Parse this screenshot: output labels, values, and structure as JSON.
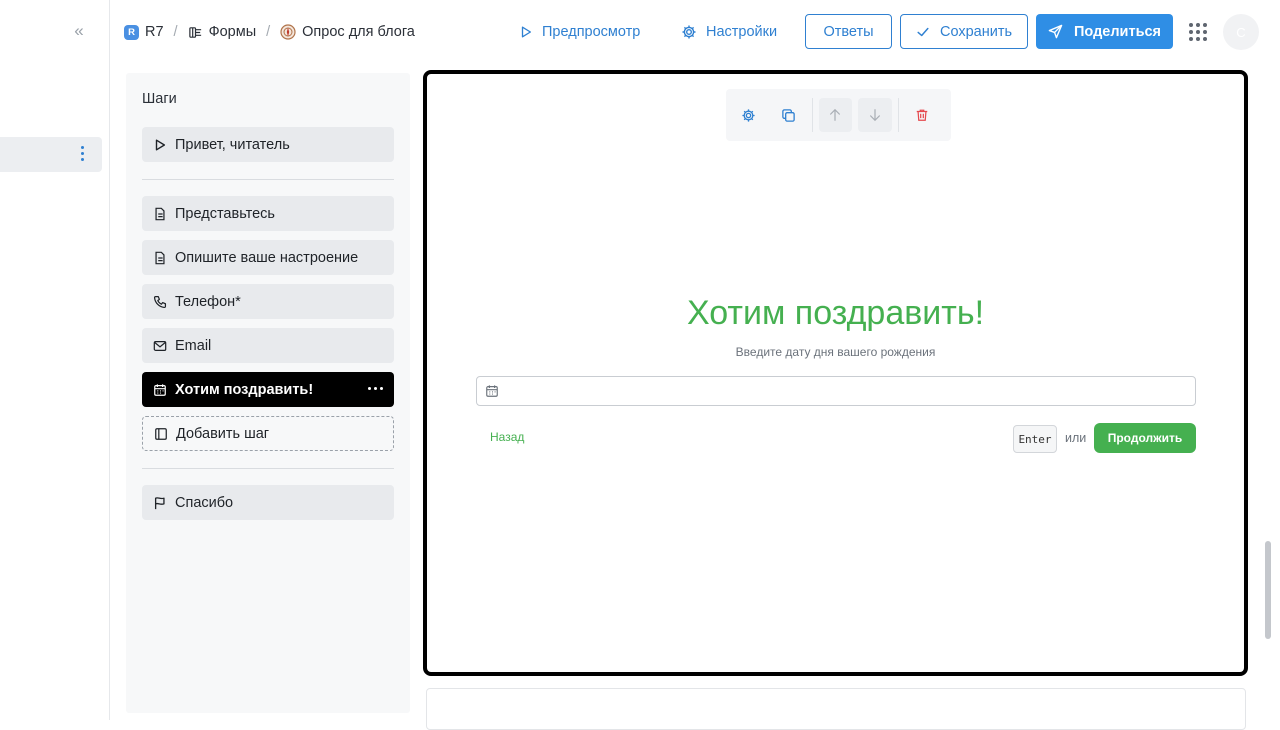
{
  "breadcrumbs": {
    "workspace_badge": "R",
    "workspace": "R7",
    "section": "Формы",
    "form": "Опрос для блога"
  },
  "header": {
    "preview_label": "Предпросмотр",
    "settings_label": "Настройки",
    "responses_label": "Ответы",
    "save_label": "Сохранить",
    "share_label": "Поделиться",
    "avatar_initial": "C"
  },
  "steps": {
    "title": "Шаги",
    "welcome": {
      "label": "Привет, читатель",
      "icon": "play-icon"
    },
    "items": [
      {
        "label": "Представьтесь",
        "icon": "document-icon"
      },
      {
        "label": "Опишите ваше настроение",
        "icon": "document-icon"
      },
      {
        "label": "Телефон*",
        "icon": "phone-icon"
      },
      {
        "label": "Email",
        "icon": "mail-icon"
      },
      {
        "label": "Хотим поздравить!",
        "icon": "calendar-icon",
        "active": true
      }
    ],
    "add_step_label": "Добавить шаг",
    "ending": {
      "label": "Спасибо",
      "icon": "flag-icon"
    }
  },
  "question": {
    "title": "Хотим поздравить!",
    "subtitle": "Введите дату дня вашего рождения",
    "input_value": "",
    "back_label": "Назад",
    "enter_key": "Enter",
    "or_label": "или",
    "continue_label": "Продолжить"
  },
  "colors": {
    "accent": "#2f80d1",
    "primary_button": "#2f8ee5",
    "form_green": "#45b050",
    "active_step": "#000000",
    "delete_red": "#e5484d"
  }
}
